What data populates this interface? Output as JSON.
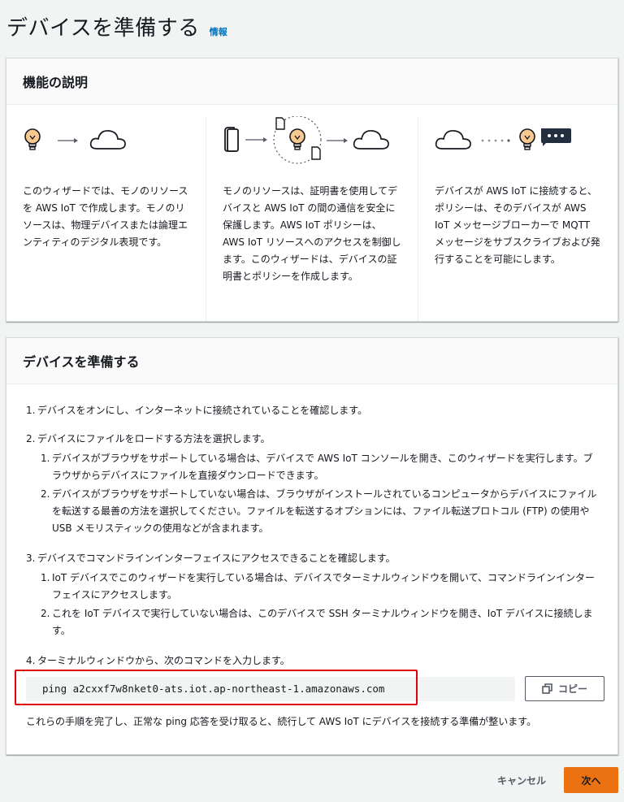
{
  "page": {
    "title": "デバイスを準備する",
    "info_link": "情報"
  },
  "features": {
    "header": "機能の説明",
    "columns": [
      {
        "text": "このウィザードでは、モノのリソースを AWS IoT で作成します。モノのリソースは、物理デバイスまたは論理エンティティのデジタル表現です。"
      },
      {
        "text": "モノのリソースは、証明書を使用してデバイスと AWS IoT の間の通信を安全に保護します。AWS IoT ポリシーは、AWS IoT リソースへのアクセスを制御します。このウィザードは、デバイスの証明書とポリシーを作成します。"
      },
      {
        "text": "デバイスが AWS IoT に接続すると、ポリシーは、そのデバイスが AWS IoT メッセージブローカーで MQTT メッセージをサブスクライブおよび発行することを可能にします。"
      }
    ]
  },
  "prepare": {
    "header": "デバイスを準備する",
    "steps": [
      {
        "num": "1.",
        "text": "デバイスをオンにし、インターネットに接続されていることを確認します。"
      },
      {
        "num": "2.",
        "text": "デバイスにファイルをロードする方法を選択します。",
        "substeps": [
          {
            "num": "1.",
            "text": "デバイスがブラウザをサポートしている場合は、デバイスで AWS IoT コンソールを開き、このウィザードを実行します。ブラウザからデバイスにファイルを直接ダウンロードできます。"
          },
          {
            "num": "2.",
            "text": "デバイスがブラウザをサポートしていない場合は、ブラウザがインストールされているコンピュータからデバイスにファイルを転送する最善の方法を選択してください。ファイルを転送するオプションには、ファイル転送プロトコル (FTP) の使用や USB メモリスティックの使用などが含まれます。"
          }
        ]
      },
      {
        "num": "3.",
        "text": "デバイスでコマンドラインインターフェイスにアクセスできることを確認します。",
        "substeps": [
          {
            "num": "1.",
            "text": "IoT デバイスでこのウィザードを実行している場合は、デバイスでターミナルウィンドウを開いて、コマンドラインインターフェイスにアクセスします。"
          },
          {
            "num": "2.",
            "text": "これを IoT デバイスで実行していない場合は、このデバイスで SSH ターミナルウィンドウを開き、IoT デバイスに接続します。"
          }
        ]
      },
      {
        "num": "4.",
        "text": "ターミナルウィンドウから、次のコマンドを入力します。"
      }
    ],
    "command": "ping a2cxxf7w8nket0-ats.iot.ap-northeast-1.amazonaws.com",
    "copy_label": "コピー",
    "closing": "これらの手順を完了し、正常な ping 応答を受け取ると、続行して AWS IoT にデバイスを接続する準備が整います。"
  },
  "footer": {
    "cancel_label": "キャンセル",
    "next_label": "次へ"
  },
  "colors": {
    "accent": "#ec7211",
    "link": "#0073bb",
    "highlight": "#e0000a"
  }
}
